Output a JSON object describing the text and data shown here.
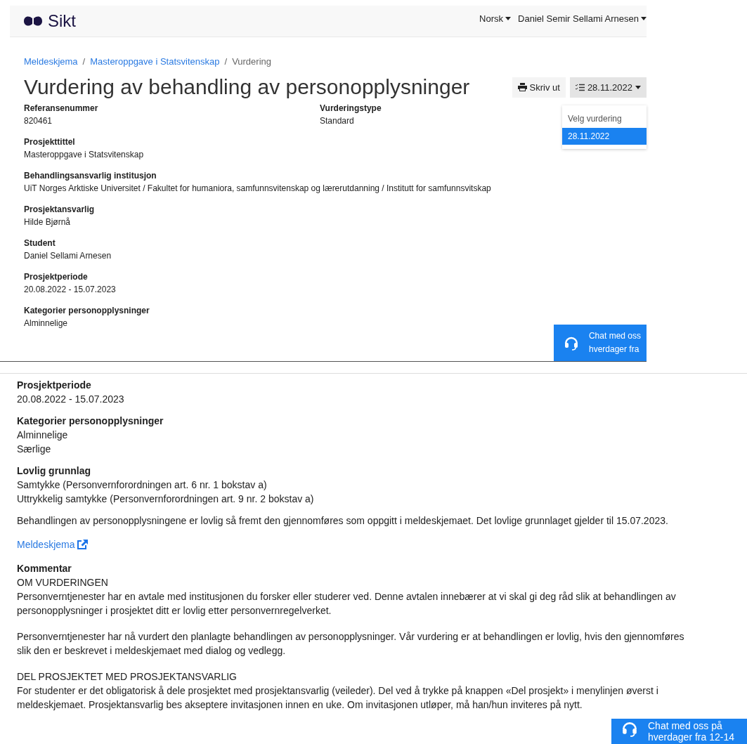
{
  "top_panel": {
    "header": {
      "logo": "Sikt",
      "language": "Norsk",
      "user": "Daniel Semir Sellami Arnesen"
    },
    "breadcrumb_separator": "/",
    "breadcrumb": [
      {
        "label": "Meldeskjema",
        "link": true
      },
      {
        "label": "Masteroppgave i Statsvitenskap",
        "link": true
      },
      {
        "label": "Vurdering",
        "link": false
      }
    ],
    "title": "Vurdering av behandling av personopplysninger",
    "print_button": "Skriv ut",
    "version_dropdown": {
      "label": "28.11.2022",
      "expanded": true,
      "header": "Velg vurdering",
      "items": [
        {
          "label": "28.11.2022",
          "selected": true
        }
      ]
    },
    "fields": [
      {
        "label": "Referansenummer",
        "values": [
          "820461"
        ],
        "side": {
          "label": "Vurderingstype",
          "values": [
            "Standard"
          ]
        }
      },
      {
        "label": "Prosjekttittel",
        "values": [
          "Masteroppgave i Statsvitenskap"
        ]
      },
      {
        "label": "Behandlingsansvarlig institusjon",
        "values": [
          "UiT Norges Arktiske Universitet / Fakultet for humaniora, samfunnsvitenskap og lærerutdanning / Institutt for samfunnsvitskap"
        ]
      },
      {
        "label": "Prosjektansvarlig",
        "values": [
          "Hilde Bjørnå"
        ]
      },
      {
        "label": "Student",
        "values": [
          "Daniel Sellami Arnesen"
        ]
      },
      {
        "label": "Prosjektperiode",
        "values": [
          "20.08.2022 - 15.07.2023"
        ]
      },
      {
        "label": "Kategorier personopplysninger",
        "values": [
          "Alminnelige"
        ]
      }
    ],
    "chat": [
      "Chat med oss",
      "hverdager fra"
    ]
  },
  "bottom_panel": {
    "fields": [
      {
        "label": "Prosjektperiode",
        "values": [
          "20.08.2022 - 15.07.2023"
        ]
      },
      {
        "label": "Kategorier personopplysninger",
        "values": [
          "Alminnelige",
          "Særlige"
        ]
      },
      {
        "label": "Lovlig grunnlag",
        "values": [
          "Samtykke (Personvernforordningen art. 6 nr. 1 bokstav a)",
          "Uttrykkelig samtykke (Personvernforordningen art. 9 nr. 2 bokstav a)"
        ]
      }
    ],
    "statement": "Behandlingen av personopplysningene er lovlig så fremt den gjennomføres som oppgitt i meldeskjemaet. Det lovlige grunnlaget gjelder til 15.07.2023.",
    "link": "Meldeskjema",
    "comment": {
      "label": "Kommentar",
      "sections": [
        {
          "heading": "OM VURDERINGEN",
          "paragraphs": [
            "Personverntjenester har en avtale med institusjonen du forsker eller studerer ved. Denne avtalen innebærer at vi skal gi deg råd slik at behandlingen av personopplysninger i prosjektet ditt er lovlig etter personvernregelverket.",
            "Personverntjenester har nå vurdert den planlagte behandlingen av personopplysninger. Vår vurdering er at behandlingen er lovlig, hvis den gjennomføres slik den er beskrevet i meldeskjemaet med dialog og vedlegg."
          ]
        },
        {
          "heading": "DEL PROSJEKTET MED PROSJEKTANSVARLIG",
          "paragraphs": [
            "For studenter er det obligatorisk å dele prosjektet med prosjektansvarlig (veileder). Del ved å trykke på knappen «Del prosjekt» i menylinjen øverst i meldeskjemaet. Prosjektansvarlig bes akseptere invitasjonen innen en uke. Om invitasjonen utløper, må han/hun inviteres på nytt."
          ]
        }
      ]
    },
    "chat": [
      "Chat med oss på",
      "hverdager fra 12-14"
    ]
  }
}
